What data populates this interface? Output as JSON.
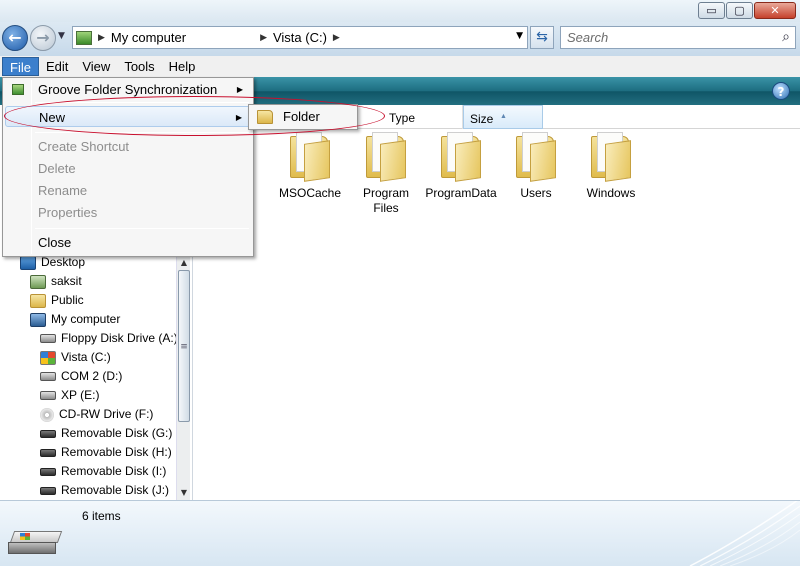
{
  "window": {
    "buttons": {
      "minimize": "▭",
      "maximize": "▢",
      "close": "✕"
    }
  },
  "address": {
    "crumbs": [
      "My computer",
      "Vista (C:)"
    ],
    "chevron": "▶",
    "dropdown": "▼"
  },
  "search": {
    "placeholder": "Search"
  },
  "menubar": {
    "items": [
      "File",
      "Edit",
      "View",
      "Tools",
      "Help"
    ]
  },
  "columns": {
    "type": "Type",
    "size": "Size"
  },
  "folders": [
    {
      "label": "MSOCache"
    },
    {
      "label": "Program Files"
    },
    {
      "label": "ProgramData"
    },
    {
      "label": "Users"
    },
    {
      "label": "Windows"
    }
  ],
  "tree": {
    "items": [
      {
        "label": "Desktop",
        "icon": "desktop-icon"
      },
      {
        "label": "saksit",
        "icon": "user-folder-icon"
      },
      {
        "label": "Public",
        "icon": "folder-icon"
      },
      {
        "label": "My computer",
        "icon": "computer-icon"
      },
      {
        "label": "Floppy Disk Drive (A:)",
        "icon": "floppy-drive-icon"
      },
      {
        "label": "Vista (C:)",
        "icon": "windows-drive-icon"
      },
      {
        "label": "COM 2 (D:)",
        "icon": "hard-drive-icon"
      },
      {
        "label": "XP (E:)",
        "icon": "hard-drive-icon"
      },
      {
        "label": "CD-RW Drive (F:)",
        "icon": "cd-drive-icon"
      },
      {
        "label": "Removable Disk (G:)",
        "icon": "removable-disk-icon"
      },
      {
        "label": "Removable Disk (H:)",
        "icon": "removable-disk-icon"
      },
      {
        "label": "Removable Disk (I:)",
        "icon": "removable-disk-icon"
      },
      {
        "label": "Removable Disk (J:)",
        "icon": "removable-disk-icon"
      }
    ]
  },
  "file_menu": {
    "items": [
      {
        "label": "Groove Folder Synchronization",
        "enabled": true,
        "submenu": true
      },
      {
        "label": "New",
        "enabled": true,
        "submenu": true,
        "highlighted": true
      },
      {
        "label": "Create Shortcut",
        "enabled": false
      },
      {
        "label": "Delete",
        "enabled": false
      },
      {
        "label": "Rename",
        "enabled": false
      },
      {
        "label": "Properties",
        "enabled": false
      },
      {
        "label": "Close",
        "enabled": true
      }
    ],
    "submenu_arrow": "▶"
  },
  "new_submenu": {
    "items": [
      {
        "label": "Folder"
      }
    ]
  },
  "help": {
    "label": "?"
  },
  "status": {
    "item_count": "6 items"
  },
  "colors": {
    "accent": "#3c7fcc",
    "command_bar": "#1d6d80",
    "annotation": "#c8102e",
    "disabled_text": "#8d8d8d"
  }
}
